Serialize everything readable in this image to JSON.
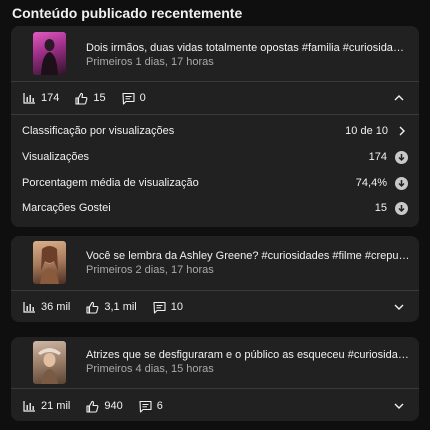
{
  "section": {
    "title": "Conteúdo publicado recentemente"
  },
  "videos": [
    {
      "title": "Dois irmãos, duas vidas totalmente opostas #familia #curiosidades #fa...",
      "subtitle": "Primeiros 1 dias, 17 horas",
      "views": "174",
      "likes": "15",
      "comments": "0",
      "expanded": true,
      "thumb_colors": [
        "#d64ab8",
        "#3a1c33"
      ]
    },
    {
      "title": "Você se lembra da Ashley Greene? #curiosidades #filme #crepusculo #...",
      "subtitle": "Primeiros 2 dias, 17 horas",
      "views": "36 mil",
      "likes": "3,1 mil",
      "comments": "10",
      "expanded": false,
      "thumb_colors": [
        "#c9a07e",
        "#5a3a2a"
      ]
    },
    {
      "title": "Atrizes que se desfiguraram e o público as esqueceu #curiosidades #fa...",
      "subtitle": "Primeiros 4 dias, 15 horas",
      "views": "21 mil",
      "likes": "940",
      "comments": "6",
      "expanded": false,
      "thumb_colors": [
        "#b89a84",
        "#6b4e3a"
      ]
    }
  ],
  "details": [
    {
      "label": "Classificação por visualizações",
      "value": "10 de 10",
      "icon": "chevron-right-icon"
    },
    {
      "label": "Visualizações",
      "value": "174",
      "icon": "download-circle-icon"
    },
    {
      "label": "Porcentagem média de visualização",
      "value": "74,4%",
      "icon": "download-circle-icon"
    },
    {
      "label": "Marcações Gostei",
      "value": "15",
      "icon": "download-circle-icon"
    }
  ]
}
